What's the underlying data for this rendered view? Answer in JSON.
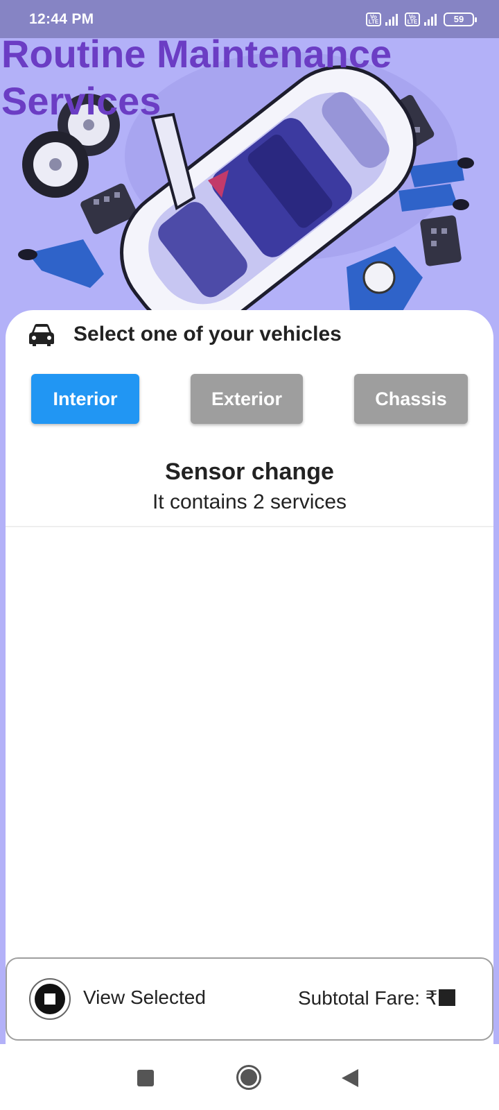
{
  "status_bar": {
    "time": "12:44 PM",
    "lte_label": "Vo LTE",
    "battery": "59"
  },
  "header": {
    "title": "Routine Maintenance Services",
    "hero_image": "car-maintenance-illustration"
  },
  "vehicle_selector": {
    "icon": "car-icon",
    "label": "Select one of your vehicles"
  },
  "tabs": [
    {
      "label": "Interior",
      "selected": true,
      "color": "#2196f3"
    },
    {
      "label": "Exterior",
      "selected": false,
      "color": "#9e9e9e"
    },
    {
      "label": "Chassis",
      "selected": false,
      "color": "#9e9e9e"
    }
  ],
  "service": {
    "title": "Sensor change",
    "subtitle": "It contains 2 services"
  },
  "bottom_bar": {
    "view_selected_label": "View Selected",
    "subtotal_label": "Subtotal Fare: ₹"
  },
  "colors": {
    "title": "#6b3dc4",
    "hero_bg": "#b3b1f8",
    "status_bar_bg": "#8684c4",
    "accent": "#2196f3"
  },
  "nav_bar": {
    "icons": [
      "recents-icon",
      "home-icon",
      "back-icon"
    ]
  }
}
